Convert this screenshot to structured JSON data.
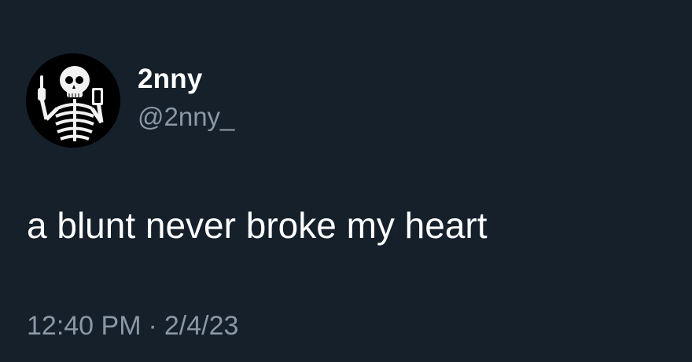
{
  "tweet": {
    "author": {
      "display_name": "2nny",
      "handle": "@2nny_",
      "avatar_icon": "skeleton-avatar-icon"
    },
    "text": "a blunt never broke my heart",
    "time": "12:40 PM",
    "separator": "·",
    "date": "2/4/23"
  },
  "colors": {
    "background": "#15202b",
    "primary_text": "#ffffff",
    "secondary_text": "#8b98a5"
  }
}
